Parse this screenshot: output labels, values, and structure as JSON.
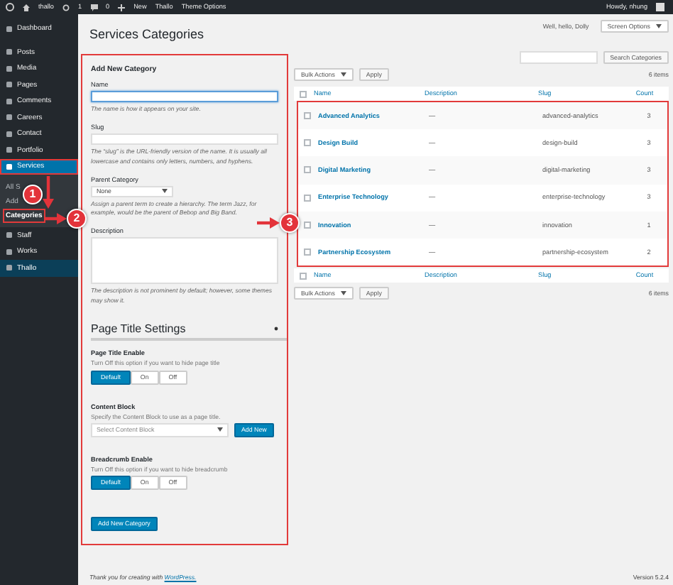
{
  "admin_bar": {
    "site": "thallo",
    "updates": "1",
    "comments": "0",
    "new": "New",
    "links": [
      "Thallo",
      "Theme Options"
    ],
    "greeting": "Howdy, nhung"
  },
  "sidebar": {
    "items": [
      {
        "label": "Dashboard",
        "selected": false,
        "hovered": false
      },
      {
        "label": "Posts",
        "selected": false,
        "hovered": false
      },
      {
        "label": "Media",
        "selected": false,
        "hovered": false
      },
      {
        "label": "Pages",
        "selected": false,
        "hovered": false
      },
      {
        "label": "Comments",
        "selected": false,
        "hovered": false
      },
      {
        "label": "Careers",
        "selected": false,
        "hovered": false
      },
      {
        "label": "Contact",
        "selected": false,
        "hovered": false
      },
      {
        "label": "Portfolio",
        "selected": false,
        "hovered": false
      },
      {
        "label": "Services",
        "selected": true,
        "hovered": false,
        "children": [
          {
            "label": "All S",
            "selected": false
          },
          {
            "label": "Add",
            "selected": false
          },
          {
            "label": "Categories",
            "selected": true
          }
        ]
      },
      {
        "label": "Staff",
        "selected": false,
        "hovered": false
      },
      {
        "label": "Works",
        "selected": false,
        "hovered": false
      },
      {
        "label": "Thallo",
        "selected": false,
        "hovered": true
      }
    ]
  },
  "header": {
    "title": "Services Categories",
    "dolly": "Well, hello, Dolly",
    "screen_options": "Screen Options"
  },
  "form": {
    "heading": "Add New Category",
    "fields": [
      {
        "kind": "text",
        "label": "Name",
        "focused": true,
        "hint": "The name is how it appears on your site."
      },
      {
        "kind": "text",
        "label": "Slug",
        "focused": false,
        "hint": "The “slug” is the URL-friendly version of the name. It is usually all lowercase and contains only letters, numbers, and hyphens."
      },
      {
        "kind": "select",
        "label": "Parent Category",
        "value": "None",
        "hint": "Assign a parent term to create a hierarchy. The term Jazz, for example, would be the parent of Bebop and Big Band."
      },
      {
        "kind": "textarea",
        "label": "Description",
        "hint": "The description is not prominent by default; however, some themes may show it."
      }
    ],
    "settings": {
      "title": "Page Title Settings",
      "groups": [
        {
          "kind": "toggle",
          "label": "Page Title Enable",
          "hint": "Turn Off this option if you want to hide page title",
          "options": [
            {
              "label": "Default",
              "selected": true
            },
            {
              "label": "On",
              "selected": false
            },
            {
              "label": "Off",
              "selected": false
            }
          ]
        },
        {
          "kind": "select",
          "label": "Content Block",
          "hint": "Specify the Content Block to use as a page title.",
          "placeholder": "Select Content Block",
          "button": "Add New"
        },
        {
          "kind": "toggle",
          "label": "Breadcrumb Enable",
          "hint": "Turn Off this option if you want to hide breadcrumb",
          "options": [
            {
              "label": "Default",
              "selected": true
            },
            {
              "label": "On",
              "selected": false
            },
            {
              "label": "Off",
              "selected": false
            }
          ]
        }
      ]
    },
    "submit": "Add New Category"
  },
  "list": {
    "search_button": "Search Categories",
    "bulk_actions": "Bulk Actions",
    "apply": "Apply",
    "count": "6 items",
    "select_all_checked": false,
    "columns": [
      "Name",
      "Description",
      "Slug",
      "Count"
    ],
    "rows": [
      {
        "name": "Advanced Analytics",
        "description": "—",
        "slug": "advanced-analytics",
        "count": "3",
        "checked": false
      },
      {
        "name": "Design Build",
        "description": "—",
        "slug": "design-build",
        "count": "3",
        "checked": false
      },
      {
        "name": "Digital Marketing",
        "description": "—",
        "slug": "digital-marketing",
        "count": "3",
        "checked": false
      },
      {
        "name": "Enterprise Technology",
        "description": "—",
        "slug": "enterprise-technology",
        "count": "3",
        "checked": false
      },
      {
        "name": "Innovation",
        "description": "—",
        "slug": "innovation",
        "count": "1",
        "checked": false
      },
      {
        "name": "Partnership Ecosystem",
        "description": "—",
        "slug": "partnership-ecosystem",
        "count": "2",
        "checked": false
      }
    ],
    "footer_select_all_checked": false,
    "footer_columns": [
      "Name",
      "Description",
      "Slug",
      "Count"
    ],
    "footer_bulk_actions": "Bulk Actions",
    "footer_apply": "Apply",
    "footer_count": "6 items"
  },
  "footer": {
    "text": "Thank you for creating with",
    "link": "WordPress.",
    "version": "Version 5.2.4"
  },
  "annotations": [
    {
      "label": "1"
    },
    {
      "label": "2"
    },
    {
      "label": "3"
    }
  ]
}
